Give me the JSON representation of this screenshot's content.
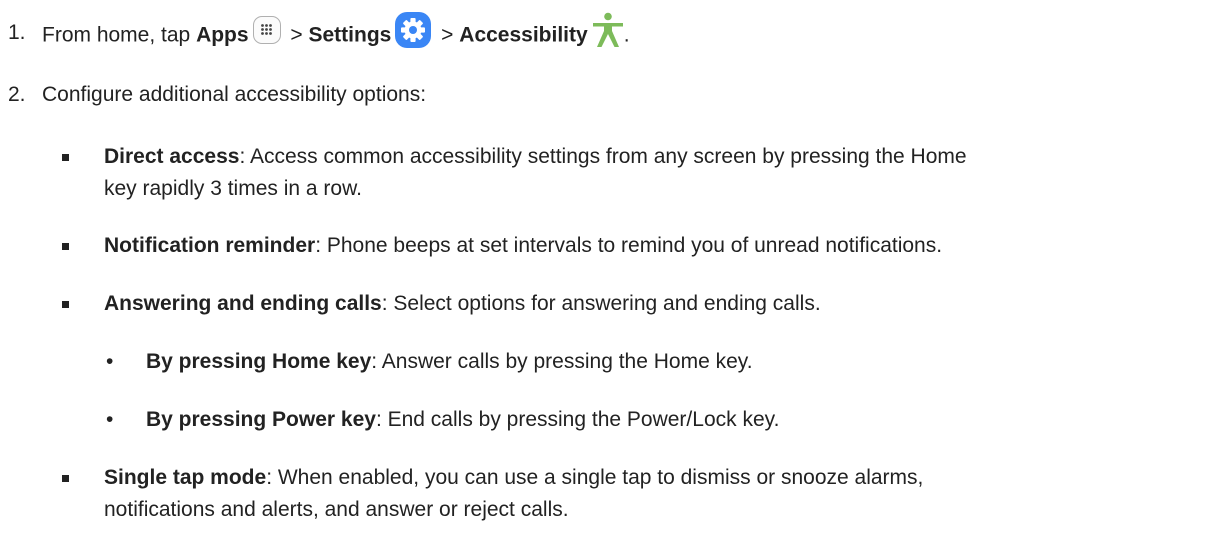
{
  "step1": {
    "number": "1.",
    "prefix": "From home, tap ",
    "apps": "Apps",
    "sep1": " > ",
    "settings": "Settings",
    "sep2": " > ",
    "accessibility": "Accessibility",
    "suffix": ".",
    "icons": {
      "apps": "apps-grid-icon",
      "settings": "settings-gear-icon",
      "accessibility": "accessibility-person-icon"
    },
    "colors": {
      "settings": "#3a86f5",
      "accessibility": "#7dbb5a"
    }
  },
  "step2": {
    "number": "2.",
    "text": "Configure additional accessibility options:"
  },
  "options": [
    {
      "title": "Direct access",
      "desc_line1": ": Access common accessibility settings from any screen by pressing the Home",
      "desc_line2": "key rapidly 3 times in a row."
    },
    {
      "title": "Notification reminder",
      "desc_line1": ": Phone beeps at set intervals to remind you of unread notifications."
    },
    {
      "title": "Answering and ending calls",
      "desc_line1": ": Select options for answering and ending calls.",
      "sub": [
        {
          "bullet": "•",
          "title": "By pressing Home key",
          "desc": ": Answer calls by pressing the Home key."
        },
        {
          "bullet": "•",
          "title": "By pressing Power key",
          "desc": ": End calls by pressing the Power/Lock key."
        }
      ]
    },
    {
      "title": "Single tap mode",
      "desc_line1": ": When enabled, you can use a single tap to dismiss or snooze alarms,",
      "desc_line2": "notifications and alerts, and answer or reject calls."
    }
  ]
}
